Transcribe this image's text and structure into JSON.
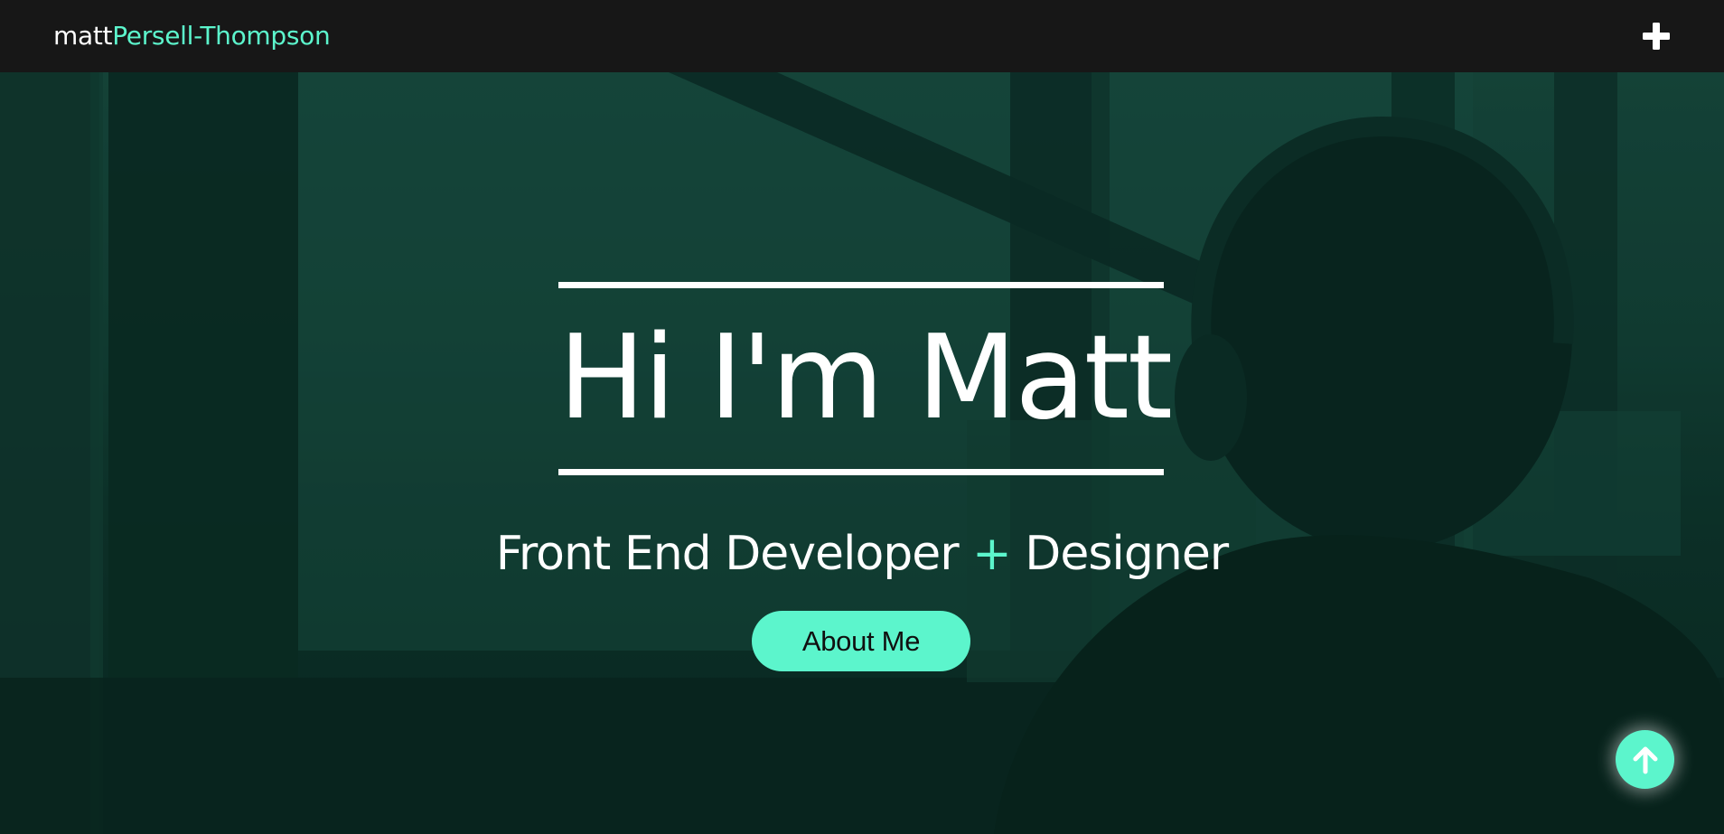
{
  "navbar": {
    "logo_first": "matt",
    "logo_last": "Persell-Thompson",
    "menu_icon": "plus-icon"
  },
  "hero": {
    "title": "Hi I'm Matt",
    "subtitle_part1": "Front End Developer",
    "subtitle_plus": "+",
    "subtitle_part2": "Designer",
    "cta_label": "About Me"
  },
  "scroll_top": {
    "icon": "arrow-up-icon"
  },
  "colors": {
    "accent": "#5cf5cc",
    "navbar_bg": "#171717",
    "text": "#ffffff",
    "hero_overlay": "#123a31"
  }
}
